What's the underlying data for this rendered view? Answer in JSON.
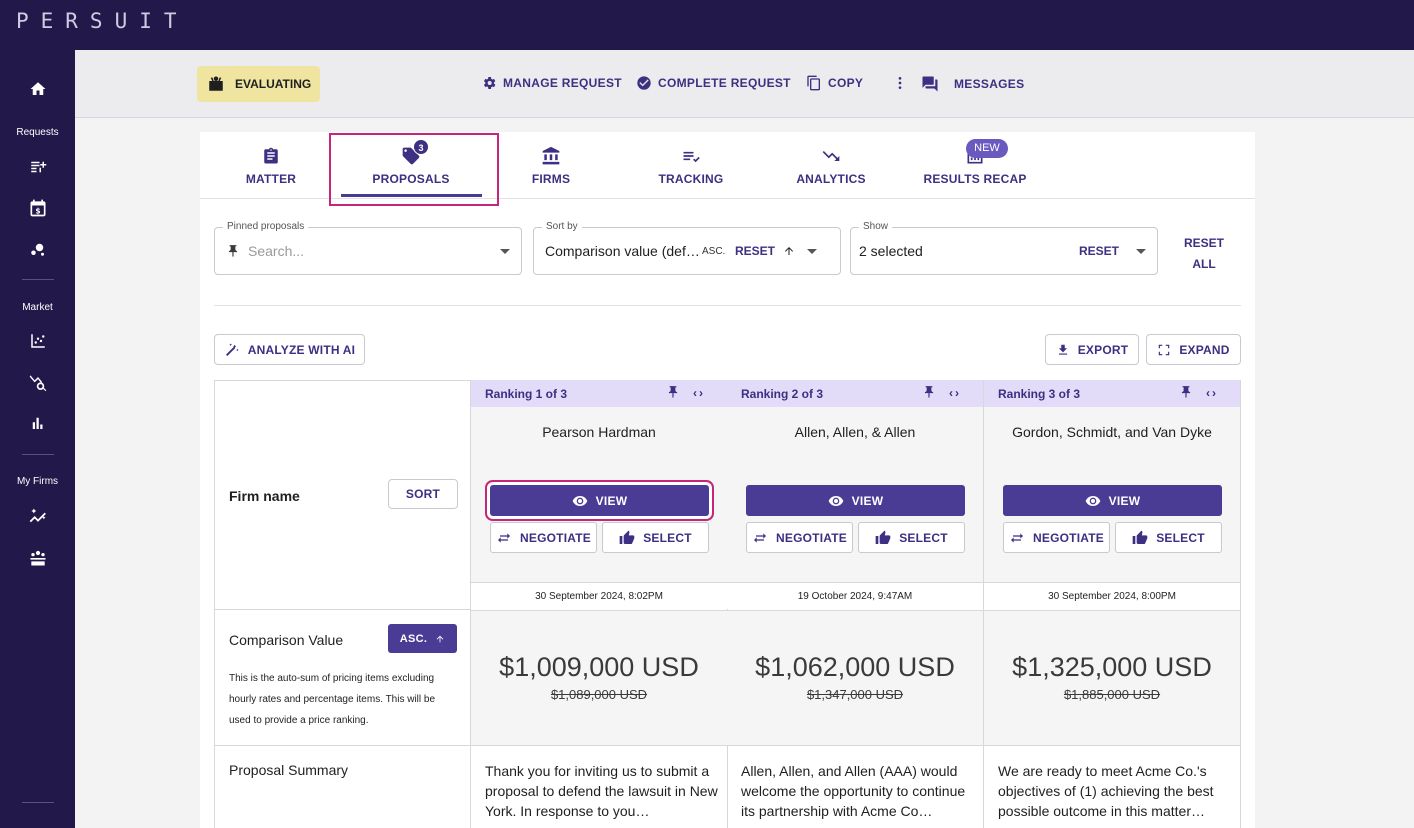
{
  "brand": "PERSUIT",
  "sidebar": {
    "sections": [
      "Requests",
      "Market",
      "My Firms"
    ]
  },
  "actionbar": {
    "status": "EVALUATING",
    "manage": "MANAGE REQUEST",
    "complete": "COMPLETE REQUEST",
    "copy": "COPY",
    "messages": "MESSAGES"
  },
  "tabs": [
    {
      "label": "MATTER"
    },
    {
      "label": "PROPOSALS",
      "badge": "3"
    },
    {
      "label": "FIRMS"
    },
    {
      "label": "TRACKING"
    },
    {
      "label": "ANALYTICS"
    },
    {
      "label": "RESULTS RECAP",
      "badge": "NEW"
    }
  ],
  "filters": {
    "pinned": {
      "label": "Pinned proposals",
      "placeholder": "Search..."
    },
    "sort": {
      "label": "Sort by",
      "value": "Comparison value (def…",
      "order": "ASC.",
      "reset": "RESET"
    },
    "show": {
      "label": "Show",
      "value": "2 selected",
      "reset": "RESET"
    },
    "reset_all_1": "RESET",
    "reset_all_2": "ALL"
  },
  "toolbar": {
    "analyze": "ANALYZE WITH AI",
    "export": "EXPORT",
    "expand": "EXPAND"
  },
  "table": {
    "rows": {
      "firm_name": "Firm name",
      "sort_btn": "SORT",
      "comparison": "Comparison Value",
      "asc_btn": "ASC.",
      "comparison_desc": "This is the auto-sum of pricing items excluding hourly rates and percentage items. This will be used to provide a price ranking.",
      "summary": "Proposal Summary"
    },
    "buttons": {
      "view": "VIEW",
      "negotiate": "NEGOTIATE",
      "select": "SELECT"
    },
    "proposals": [
      {
        "ranking": "Ranking 1 of 3",
        "firm": "Pearson Hardman",
        "timestamp": "30 September 2024, 8:02PM",
        "price": "$1,009,000 USD",
        "original": "$1,089,000 USD",
        "summary": "Thank you for inviting us to submit a proposal to defend the lawsuit in New York. In response to you…"
      },
      {
        "ranking": "Ranking 2 of 3",
        "firm": "Allen, Allen, & Allen",
        "timestamp": "19 October 2024, 9:47AM",
        "price": "$1,062,000 USD",
        "original": "$1,347,000 USD",
        "summary": "Allen, Allen, and Allen (AAA) would welcome the opportunity to continue its partnership with Acme Co…"
      },
      {
        "ranking": "Ranking 3 of 3",
        "firm": "Gordon, Schmidt, and Van Dyke",
        "timestamp": "30 September 2024, 8:00PM",
        "price": "$1,325,000 USD",
        "original": "$1,885,000 USD",
        "summary": "We are ready to meet Acme Co.'s objectives of (1) achieving the best possible outcome in this matter…"
      }
    ]
  }
}
